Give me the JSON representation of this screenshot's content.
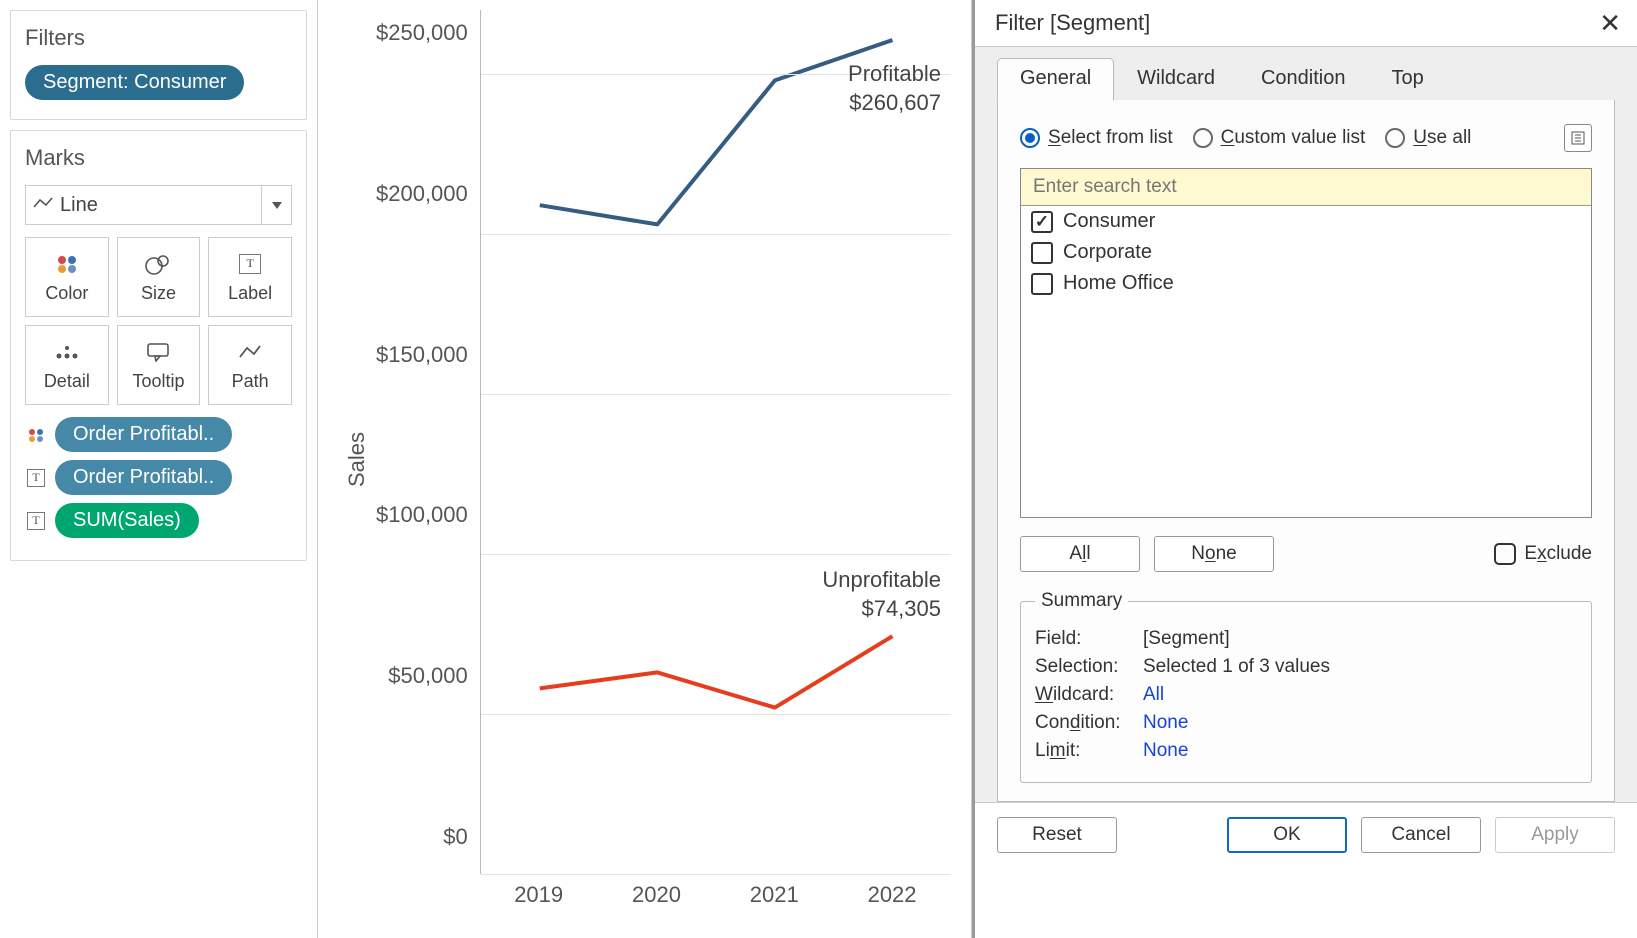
{
  "filters": {
    "title": "Filters",
    "pill": "Segment: Consumer"
  },
  "marks": {
    "title": "Marks",
    "type_label": "Line",
    "buttons": {
      "color": "Color",
      "size": "Size",
      "label": "Label",
      "detail": "Detail",
      "tooltip": "Tooltip",
      "path": "Path"
    },
    "pills": [
      {
        "lead": "color",
        "text": "Order Profitabl..",
        "color": "blue"
      },
      {
        "lead": "T",
        "text": "Order Profitabl..",
        "color": "blue"
      },
      {
        "lead": "T",
        "text": "SUM(Sales)",
        "color": "green"
      }
    ]
  },
  "chart_data": {
    "type": "line",
    "ylabel": "Sales",
    "categories": [
      "2019",
      "2020",
      "2021",
      "2022"
    ],
    "y_ticks": [
      "$250,000",
      "$200,000",
      "$150,000",
      "$100,000",
      "$50,000",
      "$0"
    ],
    "ylim": [
      0,
      270000
    ],
    "series": [
      {
        "name": "Profitable",
        "color": "#355d84",
        "values": [
          209000,
          203000,
          248000,
          260607
        ]
      },
      {
        "name": "Unprofitable",
        "color": "#e63d1c",
        "values": [
          58000,
          63000,
          52000,
          74305
        ]
      }
    ],
    "annotations": [
      {
        "series": "Profitable",
        "line1": "Profitable",
        "line2": "$260,607"
      },
      {
        "series": "Unprofitable",
        "line1": "Unprofitable",
        "line2": "$74,305"
      }
    ]
  },
  "dialog": {
    "title": "Filter [Segment]",
    "tabs": [
      "General",
      "Wildcard",
      "Condition",
      "Top"
    ],
    "active_tab": "General",
    "radios": {
      "select_from_list": "Select from list",
      "custom_value_list": "Custom value list",
      "use_all": "Use all",
      "selected": "select_from_list"
    },
    "search_placeholder": "Enter search text",
    "items": [
      {
        "label": "Consumer",
        "checked": true
      },
      {
        "label": "Corporate",
        "checked": false
      },
      {
        "label": "Home Office",
        "checked": false
      }
    ],
    "all_btn": "All",
    "none_btn": "None",
    "exclude_label": "Exclude",
    "summary": {
      "legend": "Summary",
      "field_k": "Field:",
      "field_v": "[Segment]",
      "sel_k": "Selection:",
      "sel_v": "Selected 1 of 3 values",
      "wild_k": "Wildcard:",
      "wild_v": "All",
      "cond_k": "Condition:",
      "cond_v": "None",
      "limit_k": "Limit:",
      "limit_v": "None"
    },
    "footer": {
      "reset": "Reset",
      "ok": "OK",
      "cancel": "Cancel",
      "apply": "Apply"
    }
  }
}
